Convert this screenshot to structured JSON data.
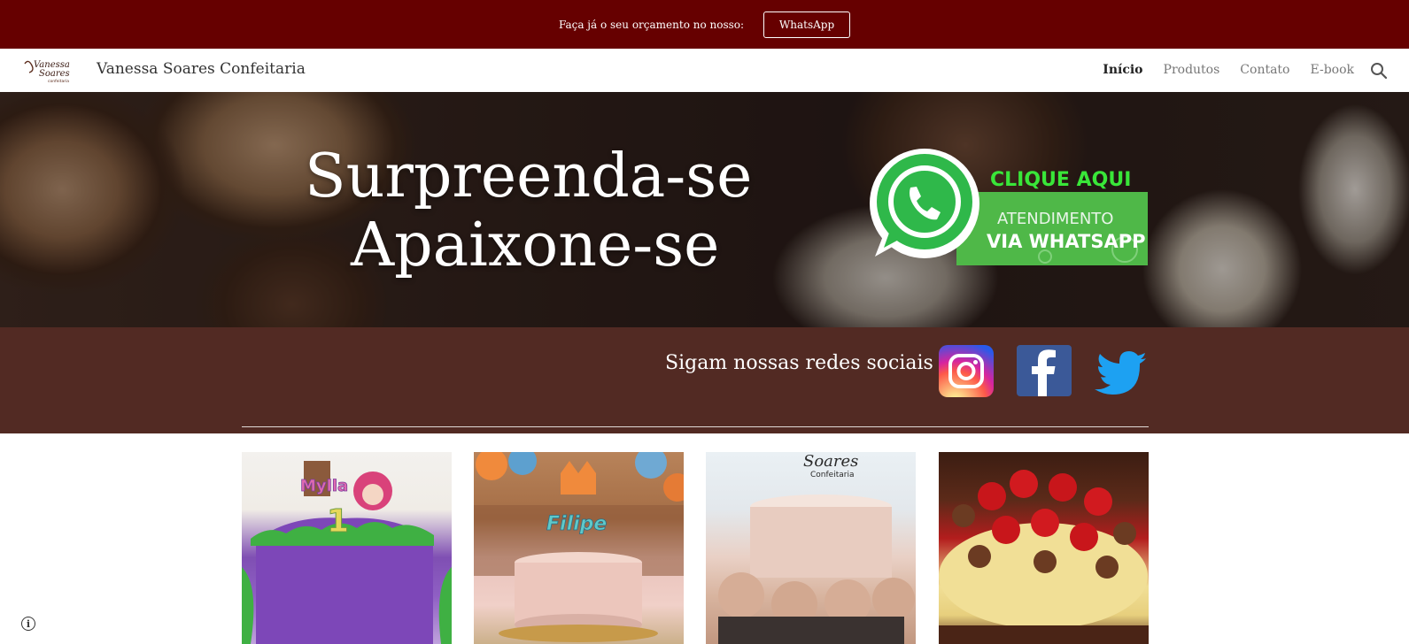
{
  "announcement": {
    "text": "Faça já o seu orçamento no nosso:",
    "button_label": "WhatsApp"
  },
  "header": {
    "logo": {
      "line1": "Vanessa",
      "line2": "Soares",
      "line3": "confeitaria"
    },
    "site_title": "Vanessa Soares Confeitaria",
    "nav": [
      {
        "label": "Início",
        "active": true
      },
      {
        "label": "Produtos",
        "active": false
      },
      {
        "label": "Contato",
        "active": false
      },
      {
        "label": "E-book",
        "active": false
      }
    ],
    "search_icon": "search-icon"
  },
  "hero": {
    "line1": "Surpreenda-se",
    "line2": "Apaixone-se",
    "whatsapp_banner": {
      "cta": "CLIQUE AQUI",
      "line1": "ATENDIMENTO",
      "line2": "VIA WHATSAPP",
      "icon": "whatsapp-icon"
    }
  },
  "social": {
    "heading": "Sigam nossas redes sociais",
    "icons": [
      "instagram-icon",
      "facebook-icon",
      "twitter-icon"
    ]
  },
  "gallery": {
    "tiles": [
      {
        "caption": "Mylla",
        "number": "1"
      },
      {
        "caption": "Filipe"
      },
      {
        "caption": "Soares",
        "subcaption": "Confeitaria"
      },
      {
        "caption": ""
      }
    ]
  },
  "footer": {
    "info_icon": "info-icon",
    "info_glyph": "i"
  },
  "colors": {
    "announce_bg": "#660000",
    "social_bg": "#522a23",
    "whatsapp_green": "#25D366",
    "facebook_blue": "#3b5998",
    "twitter_blue": "#1da1f2"
  }
}
